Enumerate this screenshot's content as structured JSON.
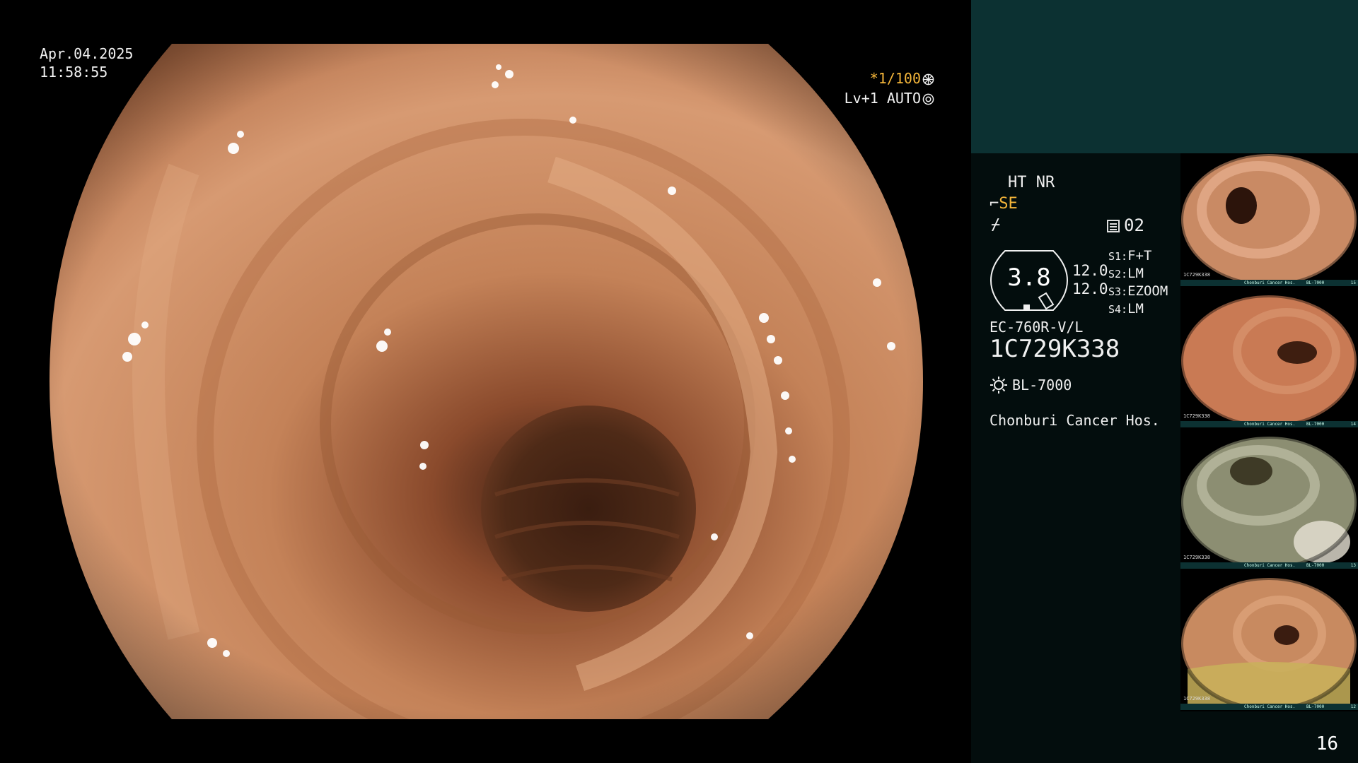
{
  "endoscope_view": {
    "date": "Apr.04.2025",
    "time": "11:58:55",
    "shutter": "*1/100",
    "iris": "Lv+1 AUTO"
  },
  "side_panel": {
    "ht_nr": "HT NR",
    "se_mode": "SE",
    "memory": "02",
    "gauge_value": "3.8",
    "enhancement_1": "12.0",
    "enhancement_2": "12.0",
    "switches": [
      {
        "key": "S1:",
        "value": "F+T"
      },
      {
        "key": "S2:",
        "value": "LM"
      },
      {
        "key": "S3:",
        "value": "EZOOM"
      },
      {
        "key": "S4:",
        "value": "LM"
      }
    ],
    "scope_model": "EC-760R-V/L",
    "scope_serial": "1C729K338",
    "light_source": "BL-7000",
    "hospital": "Chonburi Cancer Hos."
  },
  "thumbnails": [
    {
      "serial": "1C729K338",
      "hospital": "Chonburi Cancer Hos.",
      "lamp": "BL-7000",
      "index": "15"
    },
    {
      "serial": "1C729K338",
      "hospital": "Chonburi Cancer Hos.",
      "lamp": "BL-7000",
      "index": "14"
    },
    {
      "serial": "1C729K338",
      "hospital": "Chonburi Cancer Hos.",
      "lamp": "BL-7000",
      "index": "13"
    },
    {
      "serial": "1C729K338",
      "hospital": "Chonburi Cancer Hos.",
      "lamp": "BL-7000",
      "index": "12"
    }
  ],
  "page_number": "16",
  "colors": {
    "panel_top": "#0c3132",
    "panel_body": "#030d0d",
    "accent_orange": "#f5b63a",
    "mucosa_light": "#d79a72",
    "mucosa_dark": "#7a3f26",
    "lumen": "#2a140c"
  },
  "icons": {
    "shutter": "shutter-ring-icon",
    "iris": "iris-ring-icon",
    "lamp": "lamp-sun-icon",
    "memory": "memory-list-icon"
  }
}
